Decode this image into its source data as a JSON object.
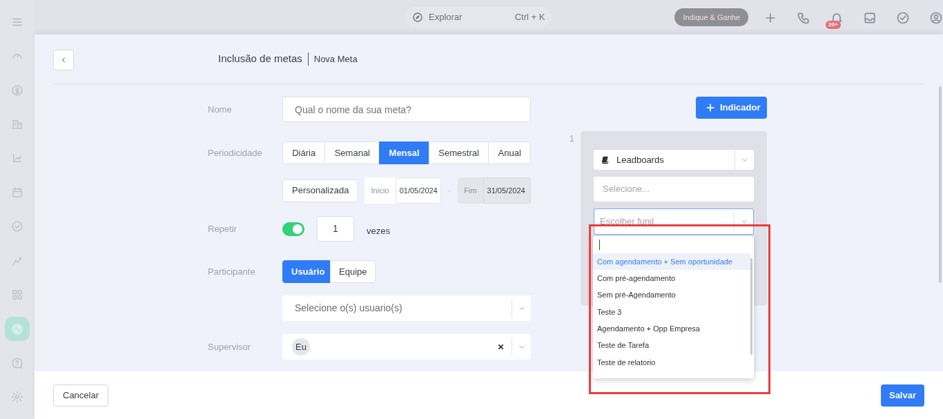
{
  "topbar": {
    "search": {
      "placeholder": "Explorar",
      "shortcut": "Ctrl + K"
    },
    "promo_button": "Indique & Ganhe",
    "notification_badge": "20+"
  },
  "sidebar": {
    "items": [
      {
        "selected": false
      },
      {
        "selected": false
      },
      {
        "selected": false
      },
      {
        "selected": false
      },
      {
        "selected": false
      },
      {
        "selected": false
      },
      {
        "selected": false
      },
      {
        "selected": false
      },
      {
        "selected": true
      },
      {
        "selected": false
      },
      {
        "selected": false
      }
    ]
  },
  "modal": {
    "title": "Inclusão de metas",
    "subtitle": "Nova Meta",
    "form": {
      "name": {
        "label": "Nome",
        "placeholder": "Qual o nome da sua meta?"
      },
      "periodicity": {
        "label": "Periodicidade",
        "options": [
          {
            "label": "Diária",
            "selected": false
          },
          {
            "label": "Semanal",
            "selected": false
          },
          {
            "label": "Mensal",
            "selected": true
          },
          {
            "label": "Semestral",
            "selected": false
          },
          {
            "label": "Anual",
            "selected": false
          }
        ],
        "custom_button": "Personalizada",
        "start": {
          "label": "Início",
          "value": "01/05/2024",
          "disabled": false
        },
        "separator": "-",
        "end": {
          "label": "Fim",
          "value": "31/05/2024",
          "disabled": true
        }
      },
      "repeat": {
        "label": "Repetir",
        "on": true,
        "count": "1",
        "suffix": "vezes"
      },
      "participant": {
        "label": "Participante",
        "options": [
          {
            "label": "Usuário",
            "selected": true
          },
          {
            "label": "Equipe",
            "selected": false
          }
        ],
        "users_placeholder": "Selecione o(s) usuario(s)"
      },
      "supervisor": {
        "label": "Supervisor",
        "chips": [
          "Eu"
        ]
      }
    },
    "add_indicator_button": "Indicador",
    "indicators": [
      {
        "number": "1",
        "source": "Leadboards",
        "field_placeholder": "Selecione...",
        "funnel_placeholder": "Escolher funil",
        "funnel_options": [
          {
            "label": "Com agendamento + Sem oportunidade",
            "selected": true
          },
          {
            "label": "Com pré-agendamento",
            "selected": false
          },
          {
            "label": "Sem pré-Agendamento",
            "selected": false
          },
          {
            "label": "Teste 3",
            "selected": false
          },
          {
            "label": "Agendamento + Opp Empresa",
            "selected": false
          },
          {
            "label": "Teste de Tarefa",
            "selected": false
          },
          {
            "label": "Teste de relatorio",
            "selected": false
          }
        ]
      }
    ],
    "footer": {
      "cancel": "Cancelar",
      "save": "Salvar"
    }
  }
}
